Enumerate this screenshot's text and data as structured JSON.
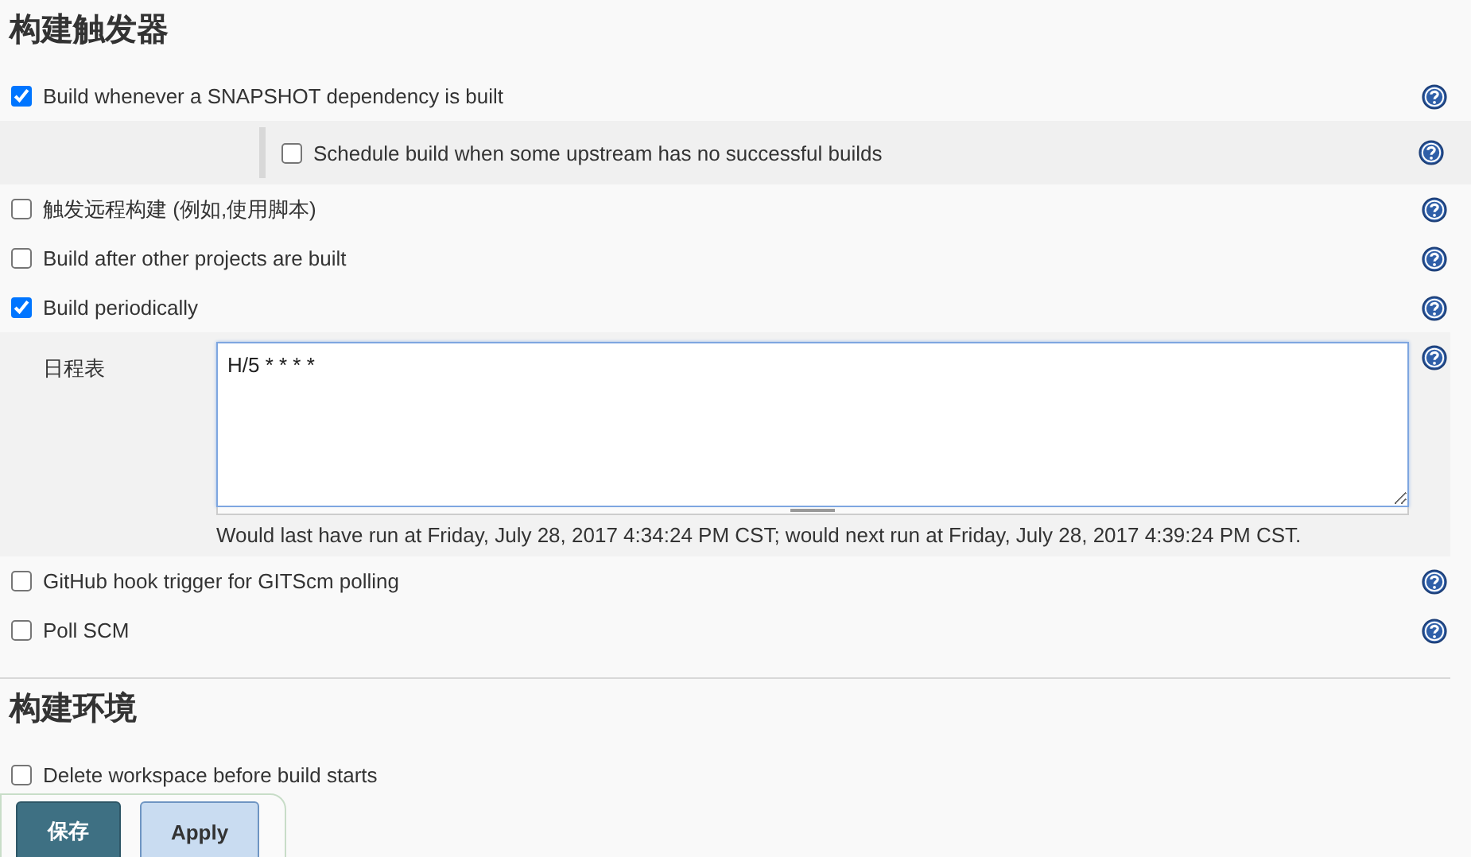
{
  "sections": [
    {
      "title": "构建触发器",
      "options": [
        {
          "kind": "checkbox",
          "label": "Build whenever a SNAPSHOT dependency is built",
          "checked": true,
          "help": true,
          "children": [
            {
              "label": "Schedule build when some upstream has no successful builds",
              "checked": false,
              "help": true
            }
          ]
        },
        {
          "kind": "checkbox",
          "label": "触发远程构建 (例如,使用脚本)",
          "checked": false,
          "help": true
        },
        {
          "kind": "checkbox",
          "label": "Build after other projects are built",
          "checked": false,
          "help": true
        },
        {
          "kind": "checkbox",
          "label": "Build periodically",
          "checked": true,
          "help": true,
          "schedule": {
            "label": "日程表",
            "value": "H/5 * * * *",
            "note": "Would last have run at Friday, July 28, 2017 4:34:24 PM CST; would next run at Friday, July 28, 2017 4:39:24 PM CST.",
            "help": true
          }
        },
        {
          "kind": "checkbox",
          "label": "GitHub hook trigger for GITScm polling",
          "checked": false,
          "help": true
        },
        {
          "kind": "checkbox",
          "label": "Poll SCM",
          "checked": false,
          "help": true
        }
      ]
    },
    {
      "title": "构建环境",
      "options": [
        {
          "kind": "checkbox",
          "label": "Delete workspace before build starts",
          "checked": false,
          "help": false
        }
      ]
    }
  ],
  "actions": [
    {
      "label": "保存",
      "kind": "primary"
    },
    {
      "label": "Apply",
      "kind": "secondary"
    }
  ]
}
